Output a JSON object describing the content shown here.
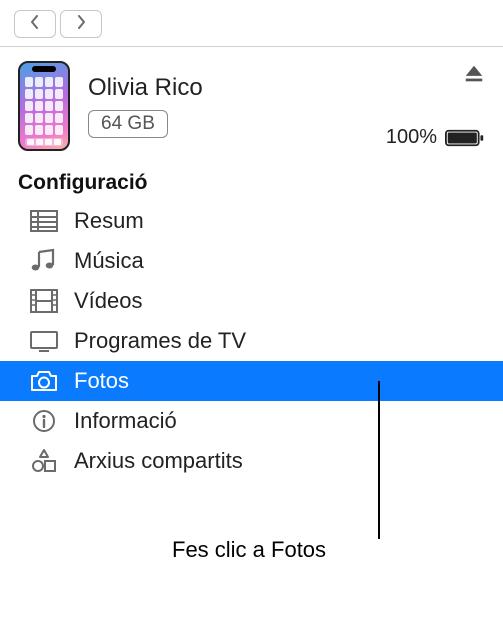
{
  "toolbar": {
    "back_label": "Back",
    "forward_label": "Forward"
  },
  "device": {
    "name": "Olivia Rico",
    "storage": "64 GB",
    "battery_pct": "100%",
    "eject_label": "Eject"
  },
  "section_header": "Configuració",
  "menu": {
    "items": [
      {
        "label": "Resum",
        "icon": "summary"
      },
      {
        "label": "Música",
        "icon": "music"
      },
      {
        "label": "Vídeos",
        "icon": "video"
      },
      {
        "label": "Programes de TV",
        "icon": "tv"
      },
      {
        "label": "Fotos",
        "icon": "camera",
        "selected": true
      },
      {
        "label": "Informació",
        "icon": "info"
      },
      {
        "label": "Arxius compartits",
        "icon": "apps"
      }
    ]
  },
  "annotation": {
    "text": "Fes clic a Fotos"
  }
}
